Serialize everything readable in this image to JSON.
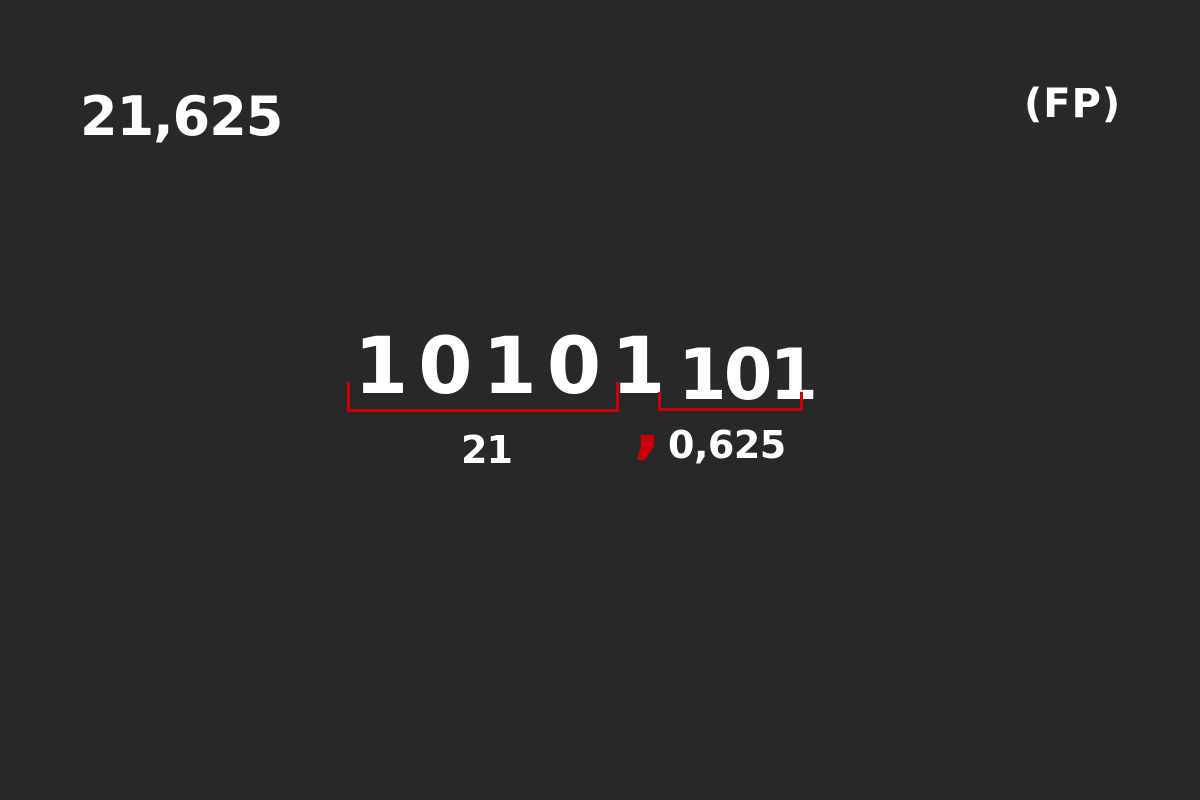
{
  "decimal_number": "21,625",
  "format_label": "(FP)",
  "binary": {
    "integer_bits": "10101",
    "radix_point": ",",
    "fraction_bits": "101"
  },
  "values": {
    "integer_value": "21",
    "fraction_value": "0,625"
  },
  "colors": {
    "background": "#282828",
    "text": "#ffffff",
    "accent": "#c8000a"
  }
}
